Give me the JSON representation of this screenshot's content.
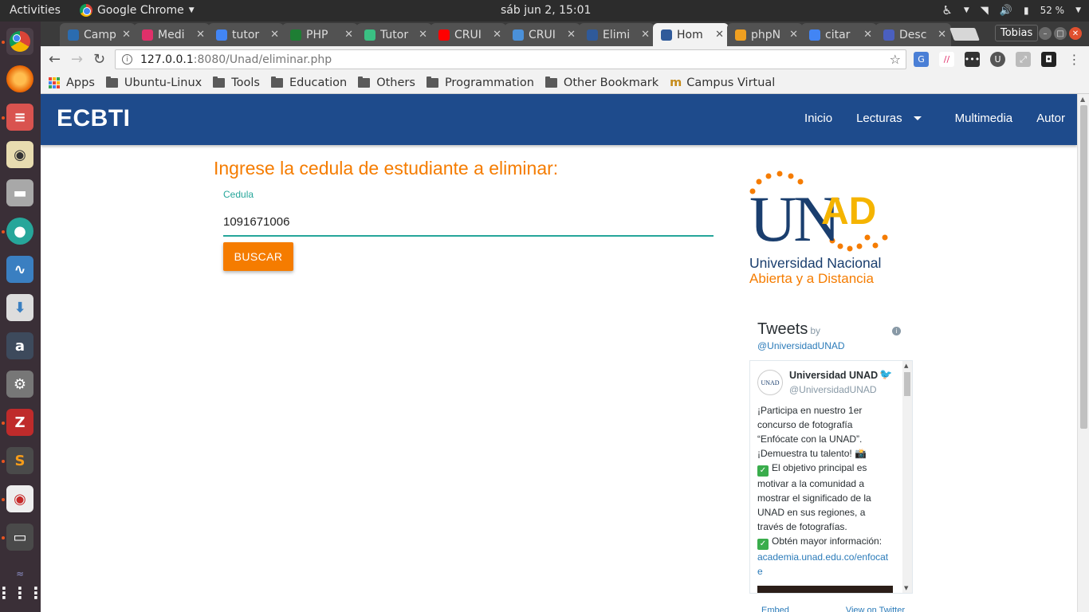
{
  "system_bar": {
    "activities": "Activities",
    "app_name": "Google Chrome",
    "clock": "sáb jun  2, 15:01",
    "battery": "52 %"
  },
  "launcher": {
    "apps": [
      "chrome",
      "firefox",
      "writer",
      "rhythmbox",
      "files",
      "inkscape",
      "monitor",
      "software",
      "amazon",
      "settings",
      "filezilla",
      "sublime",
      "viewer",
      "window",
      "trash",
      "show-apps"
    ]
  },
  "browser": {
    "tabs": [
      {
        "title": "Camp",
        "icon": "unad-icon",
        "color": "#2b6cb0"
      },
      {
        "title": "Medi",
        "icon": "medium-icon",
        "color": "#e0306a"
      },
      {
        "title": "tutor",
        "icon": "google-icon",
        "color": "#4285f4"
      },
      {
        "title": "PHP",
        "icon": "php-icon",
        "color": "#1e7e34"
      },
      {
        "title": "Tutor",
        "icon": "tutorial-icon",
        "color": "#3ac083"
      },
      {
        "title": "CRUI",
        "icon": "youtube-icon",
        "color": "#ff0000"
      },
      {
        "title": "CRUI",
        "icon": "crud-icon",
        "color": "#4a90d9"
      },
      {
        "title": "Elimi",
        "icon": "hex-icon",
        "color": "#2f5a9a"
      },
      {
        "title": "Hom",
        "icon": "hex-icon",
        "color": "#2f5a9a",
        "active": true
      },
      {
        "title": "phpN",
        "icon": "pma-icon",
        "color": "#f0a020"
      },
      {
        "title": "citar",
        "icon": "google-icon",
        "color": "#4285f4"
      },
      {
        "title": "Desc",
        "icon": "doc-icon",
        "color": "#4a5fbf"
      }
    ],
    "profile": "Tobias",
    "url_host": "127.0.0.1",
    "url_path": ":8080/Unad/eliminar.php",
    "bookmarks": [
      "Apps",
      "Ubuntu-Linux",
      "Tools",
      "Education",
      "Others",
      "Programmation",
      "Other Bookmark",
      "Campus Virtual"
    ]
  },
  "site": {
    "brand": "ECBTI",
    "nav": {
      "inicio": "Inicio",
      "lecturas": "Lecturas",
      "multimedia": "Multimedia",
      "autor": "Autor"
    },
    "heading": "Ingrese la cedula de estudiante a eliminar:",
    "field_label": "Cedula",
    "field_value": "1091671006",
    "button": "BUSCAR",
    "logo": {
      "un": "UN",
      "ad": "AD",
      "line1": "Universidad Nacional",
      "line2": "Abierta y a  Distancia"
    },
    "twitter": {
      "title": "Tweets",
      "by": "by",
      "handle": "@UniversidadUNAD",
      "user_name": "Universidad UNAD",
      "user_handle": "@UniversidadUNAD",
      "avatar_text": "UNAD",
      "tweet_lines": {
        "l1": "¡Participa en nuestro 1er concurso de fotografía “Enfócate con la UNAD”. ¡Demuestra tu talento! 📸",
        "l2": "El objetivo principal es motivar a la comunidad a mostrar el significado de la UNAD en sus regiones, a través de fotografías.",
        "l3": "Obtén mayor información:",
        "link": "academia.unad.edu.co/enfocate"
      },
      "embed": "Embed",
      "view_on": "View on Twitter"
    }
  }
}
